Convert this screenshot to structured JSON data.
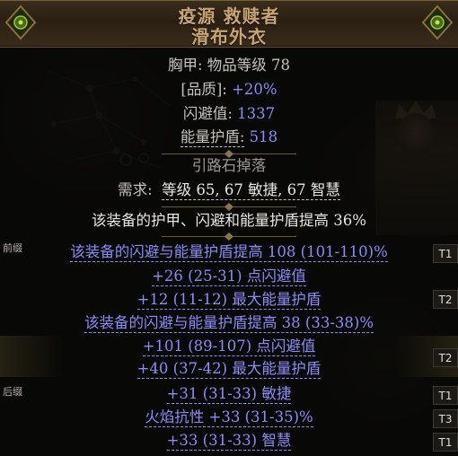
{
  "item": {
    "name": "疫源 救赎者",
    "base_type": "滑布外衣"
  },
  "properties": [
    {
      "label": "胸甲: 物品等级 78"
    },
    {
      "label": "[品质]:",
      "value": "+20%"
    },
    {
      "label": "闪避值:",
      "value": "1337"
    },
    {
      "label": "能量护盾:",
      "value": "518"
    }
  ],
  "drop_source": "引路石掉落",
  "requirements": {
    "label": "需求:",
    "text": "等级 65, 67 敏捷, 67 智慧"
  },
  "implicit": "该装备的护甲、闪避和能量护盾提高 36%",
  "side_labels": {
    "prefix": "前缀",
    "suffix": "后缀"
  },
  "mods": [
    {
      "text": "该装备的闪避与能量护盾提高 108 (101-110)%",
      "tier": "T1"
    },
    {
      "text": "+26 (25-31) 点闪避值",
      "tier": ""
    },
    {
      "text": "+12 (11-12) 最大能量护盾",
      "tier": "T2"
    },
    {
      "text": "该装备的闪避与能量护盾提高 38 (33-38)%",
      "tier": ""
    },
    {
      "text": "+101 (89-107) 点闪避值",
      "tier": ""
    },
    {
      "text": "+40 (37-42) 最大能量护盾",
      "tier": "T2"
    },
    {
      "text": "+31 (31-33) 敏捷",
      "tier": "T1"
    },
    {
      "text": "火焰抗性 +33 (31-35)%",
      "tier": "T3"
    },
    {
      "text": "+33 (31-33) 智慧",
      "tier": "T1"
    }
  ],
  "colors": {
    "header_text": "#c8a472",
    "property_text": "#c5c2bb",
    "magic_blue": "#8b8cf7",
    "white": "#e8e6e1"
  }
}
